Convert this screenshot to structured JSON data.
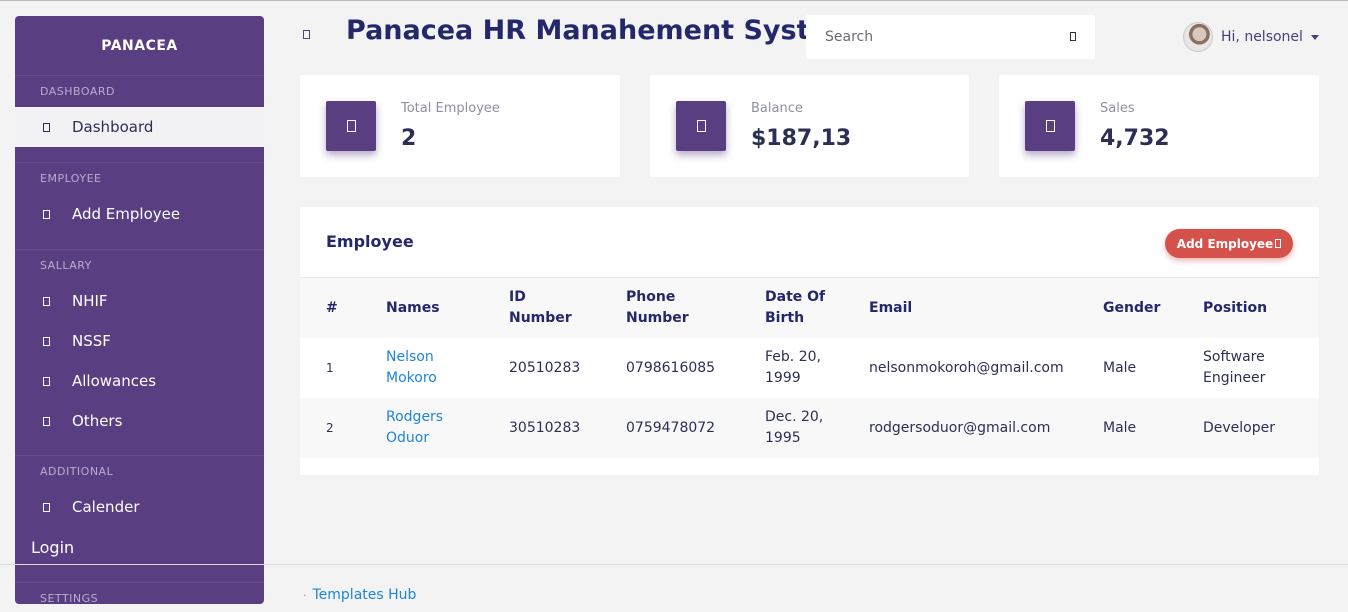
{
  "sidebar": {
    "brand": "PANACEA",
    "sections": [
      {
        "title": "DASHBOARD",
        "items": [
          {
            "label": "Dashboard",
            "icon": "dashboard-icon",
            "active": true
          }
        ]
      },
      {
        "title": "EMPLOYEE",
        "items": [
          {
            "label": "Add Employee",
            "icon": "add-employee-icon"
          }
        ]
      },
      {
        "title": "SALLARY",
        "items": [
          {
            "label": "NHIF",
            "icon": "nhif-icon"
          },
          {
            "label": "NSSF",
            "icon": "nssf-icon"
          },
          {
            "label": "Allowances",
            "icon": "allowances-icon"
          },
          {
            "label": "Others",
            "icon": "others-icon"
          }
        ]
      },
      {
        "title": "ADDITIONAL",
        "items": [
          {
            "label": "Calender",
            "icon": "calendar-icon"
          }
        ]
      }
    ],
    "login_label": "Login",
    "settings_title": "SETTINGS"
  },
  "header": {
    "title": "Panacea HR Manahement System",
    "search_placeholder": "Search",
    "greeting": "Hi, nelsonel"
  },
  "stats": [
    {
      "label": "Total Employee",
      "value": "2",
      "icon": "users-icon"
    },
    {
      "label": "Balance",
      "value": "$187,13",
      "icon": "wallet-icon"
    },
    {
      "label": "Sales",
      "value": "4,732",
      "icon": "cart-icon"
    }
  ],
  "employee_panel": {
    "title": "Employee",
    "add_button_label": "Add Employee",
    "columns": [
      "#",
      "Names",
      "ID Number",
      "Phone Number",
      "Date Of Birth",
      "Email",
      "Gender",
      "Position"
    ],
    "rows": [
      {
        "index": "1",
        "name": "Nelson Mokoro",
        "id_number": "20510283",
        "phone": "0798616085",
        "dob": "Feb. 20, 1999",
        "email": "nelsonmokoroh@gmail.com",
        "gender": "Male",
        "position": "Software Engineer"
      },
      {
        "index": "2",
        "name": "Rodgers Oduor",
        "id_number": "30510283",
        "phone": "0759478072",
        "dob": "Dec. 20, 1995",
        "email": "rodgersoduor@gmail.com",
        "gender": "Male",
        "position": "Developer"
      }
    ]
  },
  "footer": {
    "link_label": "Templates Hub"
  },
  "colors": {
    "primary": "#593f82",
    "title": "#24286a",
    "danger": "#d5514b",
    "link": "#1d85d6"
  }
}
